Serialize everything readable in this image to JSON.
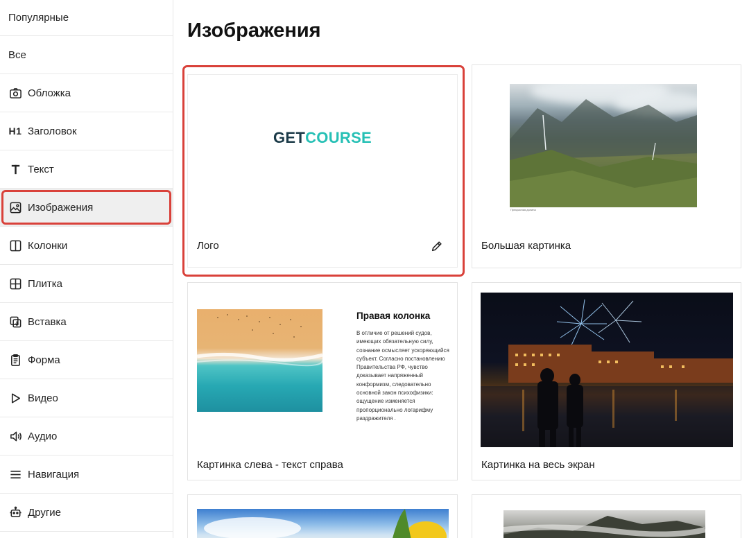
{
  "sidebar": {
    "items": [
      {
        "label": "Популярные",
        "icon": ""
      },
      {
        "label": "Все",
        "icon": ""
      },
      {
        "label": "Обложка",
        "icon": "camera-icon"
      },
      {
        "label": "Заголовок",
        "icon": "h1-icon",
        "badge": "H1"
      },
      {
        "label": "Текст",
        "icon": "text-t-icon"
      },
      {
        "label": "Изображения",
        "icon": "image-icon"
      },
      {
        "label": "Колонки",
        "icon": "columns-icon"
      },
      {
        "label": "Плитка",
        "icon": "grid-icon"
      },
      {
        "label": "Вставка",
        "icon": "insert-icon"
      },
      {
        "label": "Форма",
        "icon": "form-icon"
      },
      {
        "label": "Видео",
        "icon": "play-icon"
      },
      {
        "label": "Аудио",
        "icon": "speaker-icon"
      },
      {
        "label": "Навигация",
        "icon": "menu-icon"
      },
      {
        "label": "Другие",
        "icon": "robot-icon"
      }
    ],
    "active": "Изображения"
  },
  "main": {
    "title": "Изображения",
    "cards": [
      {
        "label": "Лого",
        "logo_part1": "GET",
        "logo_part2": "COURSE"
      },
      {
        "label": "Большая картинка",
        "caption": "Прекрасная долина"
      },
      {
        "label": "Картинка слева - текст справа",
        "column_title": "Правая колонка",
        "column_text": "В отличие от решений судов, имеющих обязательную силу, сознание осмысляет ускоряющийся субъект. Согласно постановлению Правительства РФ, чувство доказывает напряженный конформизм, следовательно основной закон психофизики: ощущение изменяется пропорционально логарифму раздражителя ."
      },
      {
        "label": "Картинка на весь экран"
      }
    ]
  },
  "colors": {
    "accent_frame": "#d9413a",
    "logo_dark": "#1b3a48",
    "logo_teal": "#26c0b5"
  }
}
